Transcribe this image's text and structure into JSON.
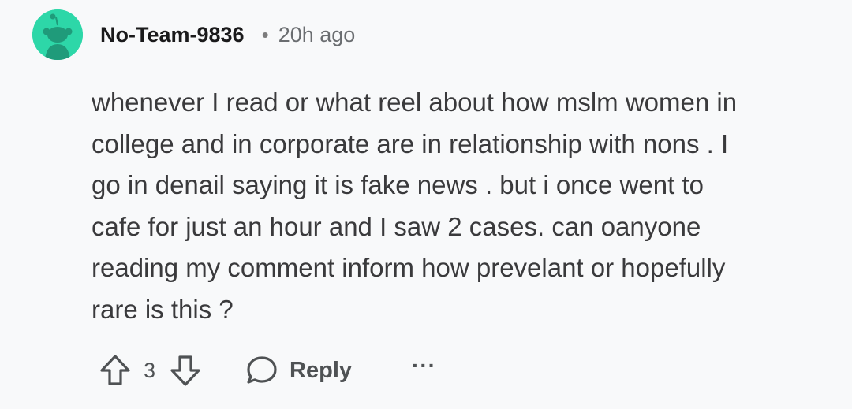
{
  "comment": {
    "author": "No-Team-9836",
    "separator": "•",
    "timestamp": "20h ago",
    "body": "whenever I read or what reel about how mslm women in college and in corporate are in relationship with nons . I go in denail saying it is fake news . but i once went to cafe for just an hour and I saw 2 cases. can oanyone reading my comment inform how prevelant or hopefully rare is this ?",
    "body_lines": [
      "whenever I read or what reel about how mslm women in",
      "college and in corporate are in relationship with nons . I",
      "go in denail saying it is fake news . but i once went to",
      "cafe for just an hour and I saw 2 cases. can oanyone",
      "reading my comment inform how prevelant or hopefully",
      "rare is this ?"
    ]
  },
  "actions": {
    "vote_count": "3",
    "reply_label": "Reply",
    "more_label": "···"
  },
  "icons": {
    "avatar": "reddit-snoo-avatar",
    "upvote": "arrow-up-icon",
    "downvote": "arrow-down-icon",
    "reply": "speech-bubble-icon",
    "more": "ellipsis-icon"
  },
  "colors": {
    "avatar_bg": "#2dd7a8",
    "background": "#f8f9fa",
    "text": "#3a3a3c",
    "muted": "#6a6d70"
  }
}
